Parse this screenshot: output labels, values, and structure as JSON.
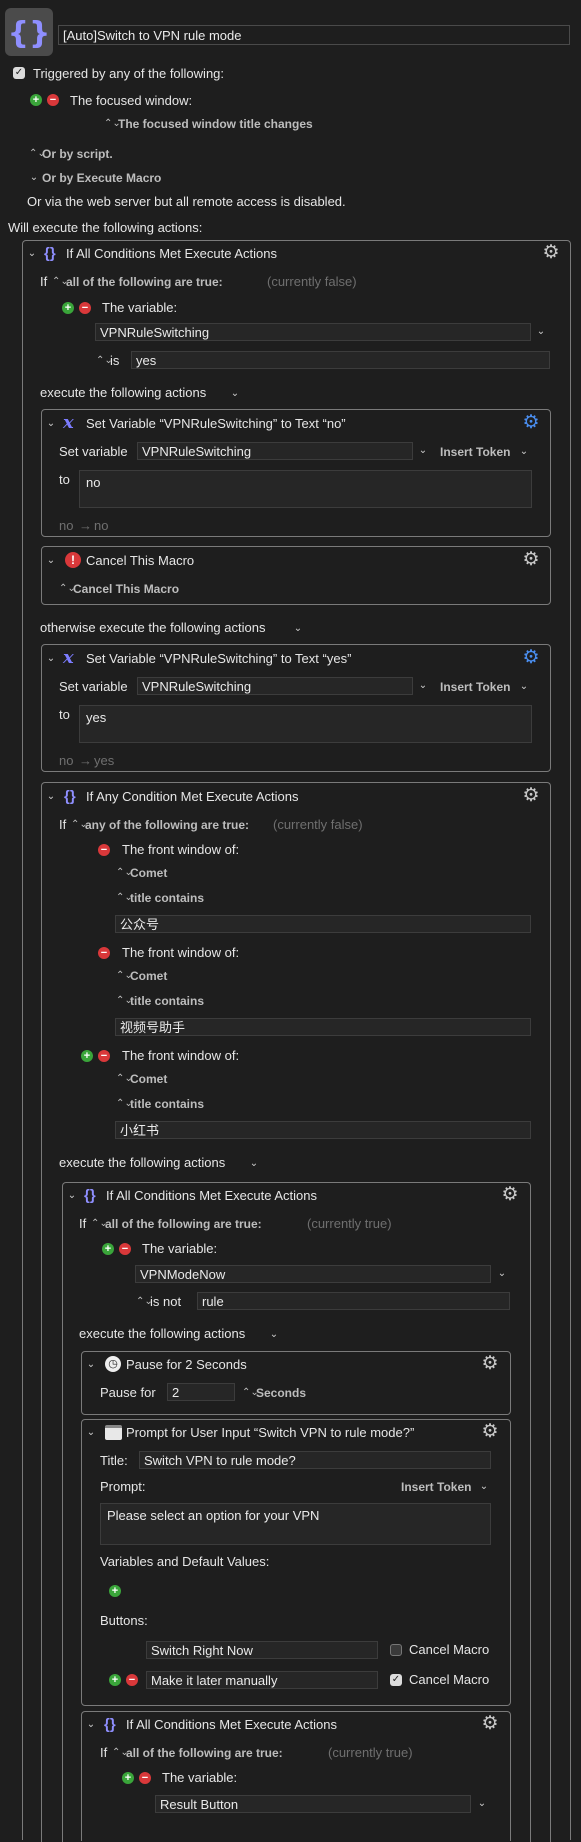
{
  "macro": {
    "title": "[Auto]Switch to VPN rule mode",
    "triggered_label": "Triggered by any of the following:",
    "focused_window": "The focused window:",
    "title_changes": "The focused window title changes",
    "or_script": "Or by script.",
    "or_execute_macro": "Or by Execute Macro",
    "web_server_note": "Or via the web server but all remote access is disabled.",
    "will_execute": "Will execute the following actions:"
  },
  "outer_if": {
    "header": "If All Conditions Met Execute Actions",
    "if": "If",
    "mode": "all of the following are true:",
    "status": "(currently false)",
    "the_variable": "The variable:",
    "variable": "VPNRuleSwitching",
    "op": "is",
    "value": "yes",
    "execute": "execute the following actions",
    "otherwise": "otherwise execute the following actions"
  },
  "set_no": {
    "header": "Set Variable “VPNRuleSwitching” to Text “no”",
    "set_variable": "Set variable",
    "variable": "VPNRuleSwitching",
    "insert_token": "Insert Token",
    "to": "to",
    "text": "no",
    "preview_from": "no",
    "arrow": "→",
    "preview_to": "no"
  },
  "cancel": {
    "header": "Cancel This Macro",
    "option": "Cancel This Macro"
  },
  "set_yes": {
    "header": "Set Variable “VPNRuleSwitching” to Text “yes”",
    "set_variable": "Set variable",
    "variable": "VPNRuleSwitching",
    "insert_token": "Insert Token",
    "to": "to",
    "text": "yes",
    "preview_from": "no",
    "arrow": "→",
    "preview_to": "yes"
  },
  "any_if": {
    "header": "If Any Condition Met Execute Actions",
    "if": "If",
    "mode": "any of the following are true:",
    "status": "(currently false)",
    "front_window": "The front window of:",
    "app": "Comet",
    "title_contains": "title contains",
    "conditions": [
      "公众号",
      "视频号助手",
      "小红书"
    ],
    "execute": "execute the following actions"
  },
  "inner_if": {
    "header": "If All Conditions Met Execute Actions",
    "if": "If",
    "mode": "all of the following are true:",
    "status": "(currently true)",
    "the_variable": "The variable:",
    "variable": "VPNModeNow",
    "op": "is not",
    "value": "rule",
    "execute": "execute the following actions"
  },
  "pause": {
    "header": "Pause for 2 Seconds",
    "label": "Pause for",
    "value": "2",
    "unit": "Seconds"
  },
  "prompt": {
    "header": "Prompt for User Input “Switch VPN to rule mode?”",
    "title_label": "Title:",
    "title_value": "Switch VPN to rule mode?",
    "prompt_label": "Prompt:",
    "insert_token": "Insert Token",
    "prompt_text": "Please select an option for your VPN",
    "vars_label": "Variables and Default Values:",
    "buttons_label": "Buttons:",
    "buttons": [
      {
        "label": "Switch Right Now",
        "cancel_label": "Cancel Macro",
        "cancel": false
      },
      {
        "label": "Make it later manually",
        "cancel_label": "Cancel Macro",
        "cancel": true
      }
    ]
  },
  "result_if": {
    "header": "If All Conditions Met Execute Actions",
    "if": "If",
    "mode": "all of the following are true:",
    "status": "(currently true)",
    "the_variable": "The variable:",
    "variable": "Result Button"
  },
  "colors": {
    "background": "#1e1e1e",
    "accent_blue": "#4a8ef0",
    "brace_purple": "#8f8fff",
    "add_green": "#3aa53a",
    "remove_red": "#d9383a"
  }
}
